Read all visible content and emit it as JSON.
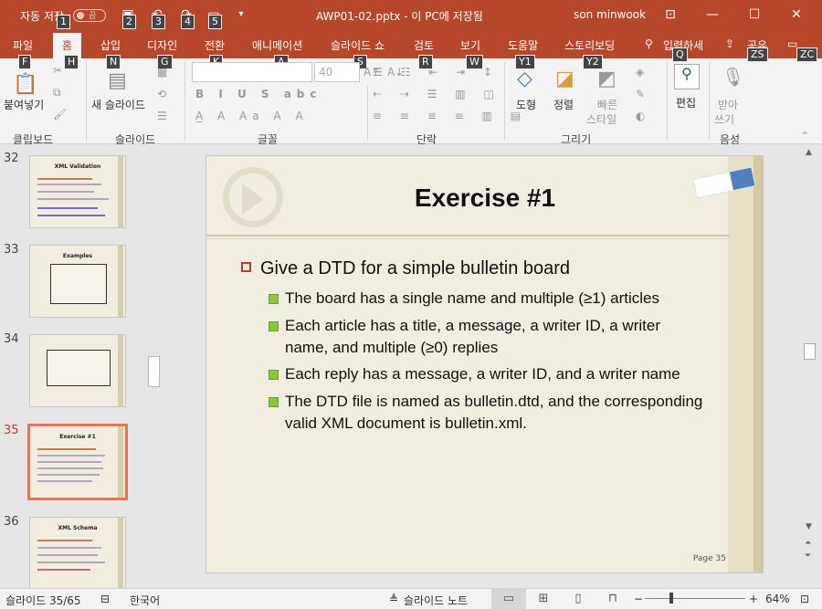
{
  "titlebar": {
    "autosave_label": "자동 저장",
    "autosave_state": "끔",
    "doc_title": "AWP01-02.pptx - 이 PC에 저장됨",
    "user": "son minwook",
    "qat_badges": [
      "1",
      "2",
      "3",
      "4",
      "5"
    ],
    "bg_color": "#b7472a"
  },
  "tabs": [
    {
      "label": "파일",
      "key": "F"
    },
    {
      "label": "홈",
      "key": "H"
    },
    {
      "label": "삽입",
      "key": "N"
    },
    {
      "label": "디자인",
      "key": "G"
    },
    {
      "label": "전환",
      "key": "K"
    },
    {
      "label": "애니메이션",
      "key": "A"
    },
    {
      "label": "슬라이드 쇼",
      "key": "S"
    },
    {
      "label": "검토",
      "key": "R"
    },
    {
      "label": "보기",
      "key": "W"
    },
    {
      "label": "도움말",
      "key": "Y1"
    },
    {
      "label": "스토리보딩",
      "key": "Y2"
    }
  ],
  "tell_me": {
    "label": "입력하세",
    "key": "Q"
  },
  "share": {
    "label": "공유",
    "key": "ZS"
  },
  "comment_key": "ZC",
  "ribbon": {
    "paste": "붙여넣기",
    "new_slide": "새 슬라이드",
    "font_size_placeholder": "40",
    "shapes": "도형",
    "arrange": "정렬",
    "quick_styles_1": "빠른",
    "quick_styles_2": "스타일",
    "editing": "편집",
    "dictate_1": "받아",
    "dictate_2": "쓰기",
    "groups": [
      "클립보드",
      "슬라이드",
      "글꼴",
      "단락",
      "그리기",
      "음성"
    ]
  },
  "thumbnails": [
    {
      "num": "32",
      "title": "XML Validation"
    },
    {
      "num": "33",
      "title": "Examples"
    },
    {
      "num": "34",
      "title": ""
    },
    {
      "num": "35",
      "title": "Exercise #1"
    },
    {
      "num": "36",
      "title": "XML Schema"
    }
  ],
  "slide": {
    "title": "Exercise #1",
    "bullet_main": "Give a DTD for a simple bulletin board",
    "sub_bullets": [
      "The board has a single name and multiple (≥1) articles",
      "Each article has a title, a message, a writer ID, a writer name, and multiple (≥0) replies",
      "Each reply has a message, a writer ID, and a writer name",
      "The DTD file is named as bulletin.dtd, and the corresponding valid XML document is bulletin.xml."
    ],
    "page_label": "Page 35"
  },
  "statusbar": {
    "slide_count": "슬라이드 35/65",
    "language": "한국어",
    "notes": "슬라이드 노트",
    "zoom": "64%"
  }
}
